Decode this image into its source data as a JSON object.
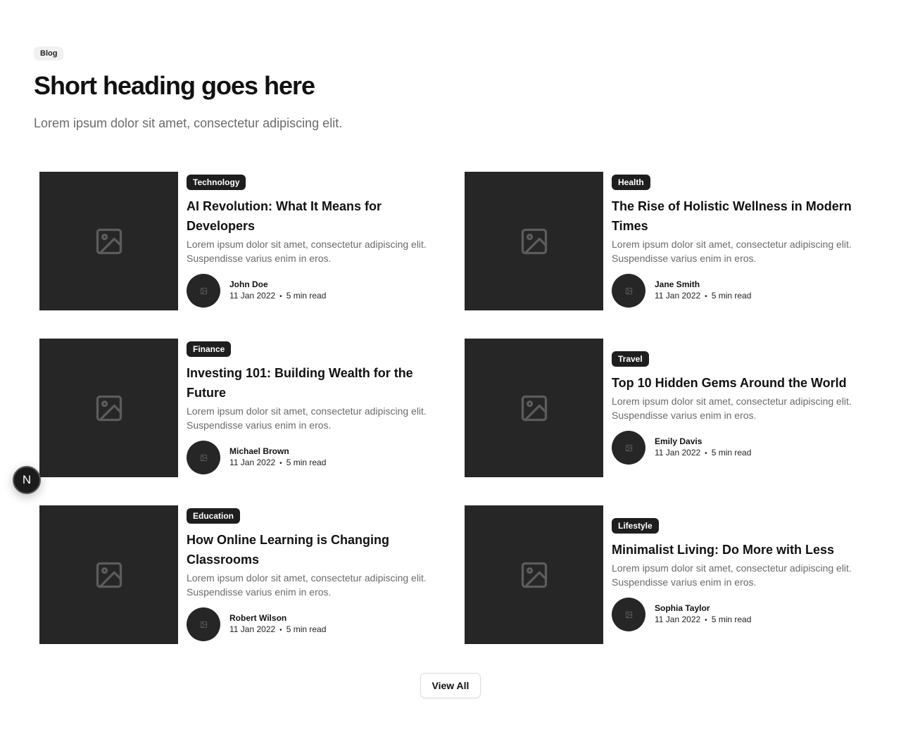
{
  "header": {
    "tagline": "Blog",
    "heading": "Short heading goes here",
    "subheading": "Lorem ipsum dolor sit amet, consectetur adipiscing elit."
  },
  "posts": [
    {
      "category": "Technology",
      "title": "AI Revolution: What It Means for Developers",
      "excerpt": "Lorem ipsum dolor sit amet, consectetur adipiscing elit. Suspendisse varius enim in eros.",
      "author": "John Doe",
      "date": "11 Jan 2022",
      "read_time": "5 min read"
    },
    {
      "category": "Health",
      "title": "The Rise of Holistic Wellness in Modern Times",
      "excerpt": "Lorem ipsum dolor sit amet, consectetur adipiscing elit. Suspendisse varius enim in eros.",
      "author": "Jane Smith",
      "date": "11 Jan 2022",
      "read_time": "5 min read"
    },
    {
      "category": "Finance",
      "title": "Investing 101: Building Wealth for the Future",
      "excerpt": "Lorem ipsum dolor sit amet, consectetur adipiscing elit. Suspendisse varius enim in eros.",
      "author": "Michael Brown",
      "date": "11 Jan 2022",
      "read_time": "5 min read"
    },
    {
      "category": "Travel",
      "title": "Top 10 Hidden Gems Around the World",
      "excerpt": "Lorem ipsum dolor sit amet, consectetur adipiscing elit. Suspendisse varius enim in eros.",
      "author": "Emily Davis",
      "date": "11 Jan 2022",
      "read_time": "5 min read"
    },
    {
      "category": "Education",
      "title": "How Online Learning is Changing Classrooms",
      "excerpt": "Lorem ipsum dolor sit amet, consectetur adipiscing elit. Suspendisse varius enim in eros.",
      "author": "Robert Wilson",
      "date": "11 Jan 2022",
      "read_time": "5 min read"
    },
    {
      "category": "Lifestyle",
      "title": "Minimalist Living: Do More with Less",
      "excerpt": "Lorem ipsum dolor sit amet, consectetur adipiscing elit. Suspendisse varius enim in eros.",
      "author": "Sophia Taylor",
      "date": "11 Jan 2022",
      "read_time": "5 min read"
    }
  ],
  "view_all_label": "View All",
  "dev_badge": {
    "letter": "N"
  },
  "icons": {
    "thumbnail": "image-placeholder-icon",
    "avatar": "image-placeholder-icon"
  },
  "colors": {
    "placeholder_bg": "#262626",
    "category_bg": "#1e1e1e",
    "muted_text": "#6b6b6b"
  }
}
